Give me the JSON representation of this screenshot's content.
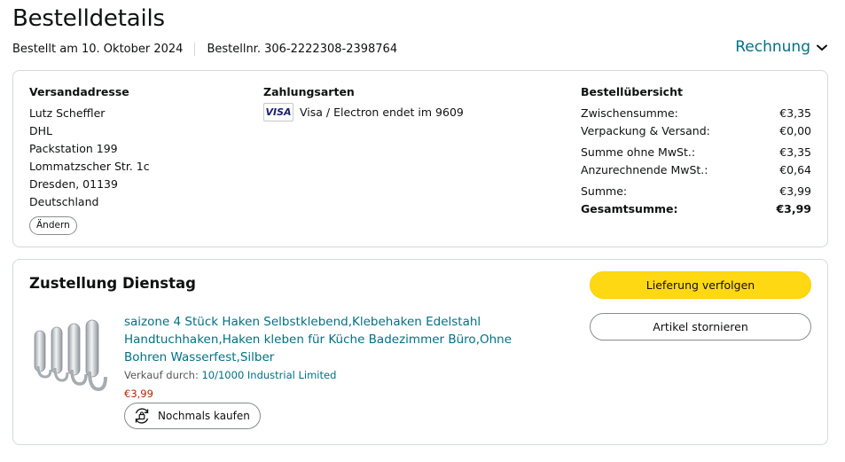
{
  "header": {
    "title": "Bestelldetails",
    "ordered_on": "Bestellt am 10. Oktober 2024",
    "order_number": "Bestellnr. 306-2222308-2398764",
    "invoice_label": "Rechnung",
    "invoice_icon": "chevron-down-icon"
  },
  "shipping": {
    "heading": "Versandadresse",
    "lines": [
      "Lutz Scheffler",
      "DHL",
      "Packstation 199",
      "Lommatzscher Str. 1c",
      "Dresden, 01139",
      "Deutschland"
    ],
    "change_label": "Ändern"
  },
  "payment": {
    "heading": "Zahlungsarten",
    "card_logo": "VISA",
    "card_text": "Visa / Electron endet im 9609"
  },
  "summary": {
    "heading": "Bestellübersicht",
    "rows": [
      {
        "label": "Zwischensumme:",
        "value": "€3,35"
      },
      {
        "label": "Verpackung & Versand:",
        "value": "€0,00"
      },
      {
        "label": "Summe ohne MwSt.:",
        "value": "€3,35"
      },
      {
        "label": "Anzurechnende MwSt.:",
        "value": "€0,64"
      },
      {
        "label": "Summe:",
        "value": "€3,99"
      },
      {
        "label": "Gesamtsumme:",
        "value": "€3,99"
      }
    ]
  },
  "delivery": {
    "title": "Zustellung Dienstag",
    "track_label": "Lieferung verfolgen",
    "cancel_label": "Artikel stornieren"
  },
  "product": {
    "title": "saizone 4 Stück Haken Selbstklebend,Klebehaken Edelstahl Handtuchhaken,Haken kleben für Küche Badezimmer Büro,Ohne Bohren Wasserfest,Silber",
    "seller_prefix": "Verkauf durch:",
    "seller_name": "10/1000 Industrial Limited",
    "price": "€3,99",
    "buy_again_label": "Nochmals kaufen",
    "buy_again_icon": "buy-again-icon"
  },
  "colors": {
    "link": "#007185",
    "price": "#b12704",
    "primary_button": "#ffd814"
  }
}
